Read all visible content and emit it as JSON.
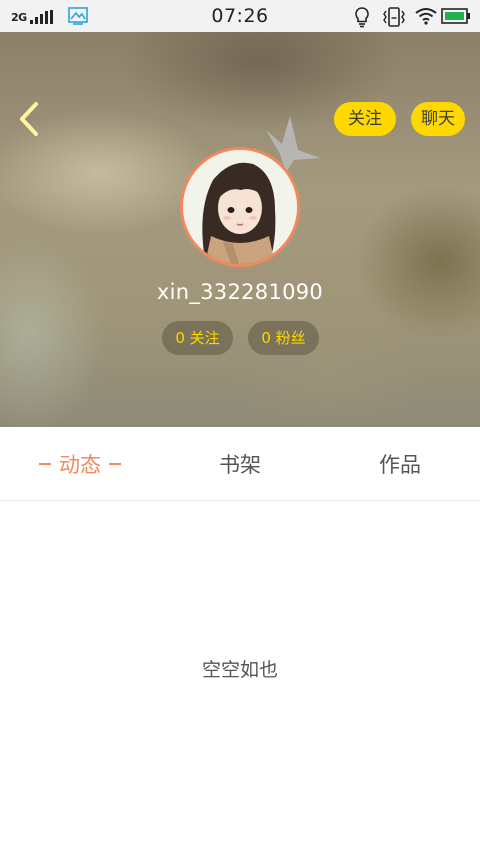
{
  "status_bar": {
    "network": "2G",
    "time": "07:26",
    "icons": [
      "signal-icon",
      "photo-icon",
      "bulb-icon",
      "vibrate-icon",
      "wifi-icon",
      "battery-icon"
    ]
  },
  "header": {
    "back_icon": "chevron-left-icon",
    "follow_label": "关注",
    "chat_label": "聊天",
    "username": "xin_332281090",
    "stats": {
      "following": "0 关注",
      "fans": "0 粉丝"
    }
  },
  "tabs": [
    {
      "label": "动态",
      "active": true
    },
    {
      "label": "书架",
      "active": false
    },
    {
      "label": "作品",
      "active": false
    }
  ],
  "content": {
    "empty_text": "空空如也"
  },
  "colors": {
    "accent": "#f08a5d",
    "button_yellow": "#ffd800",
    "tab_text": "#555555"
  }
}
